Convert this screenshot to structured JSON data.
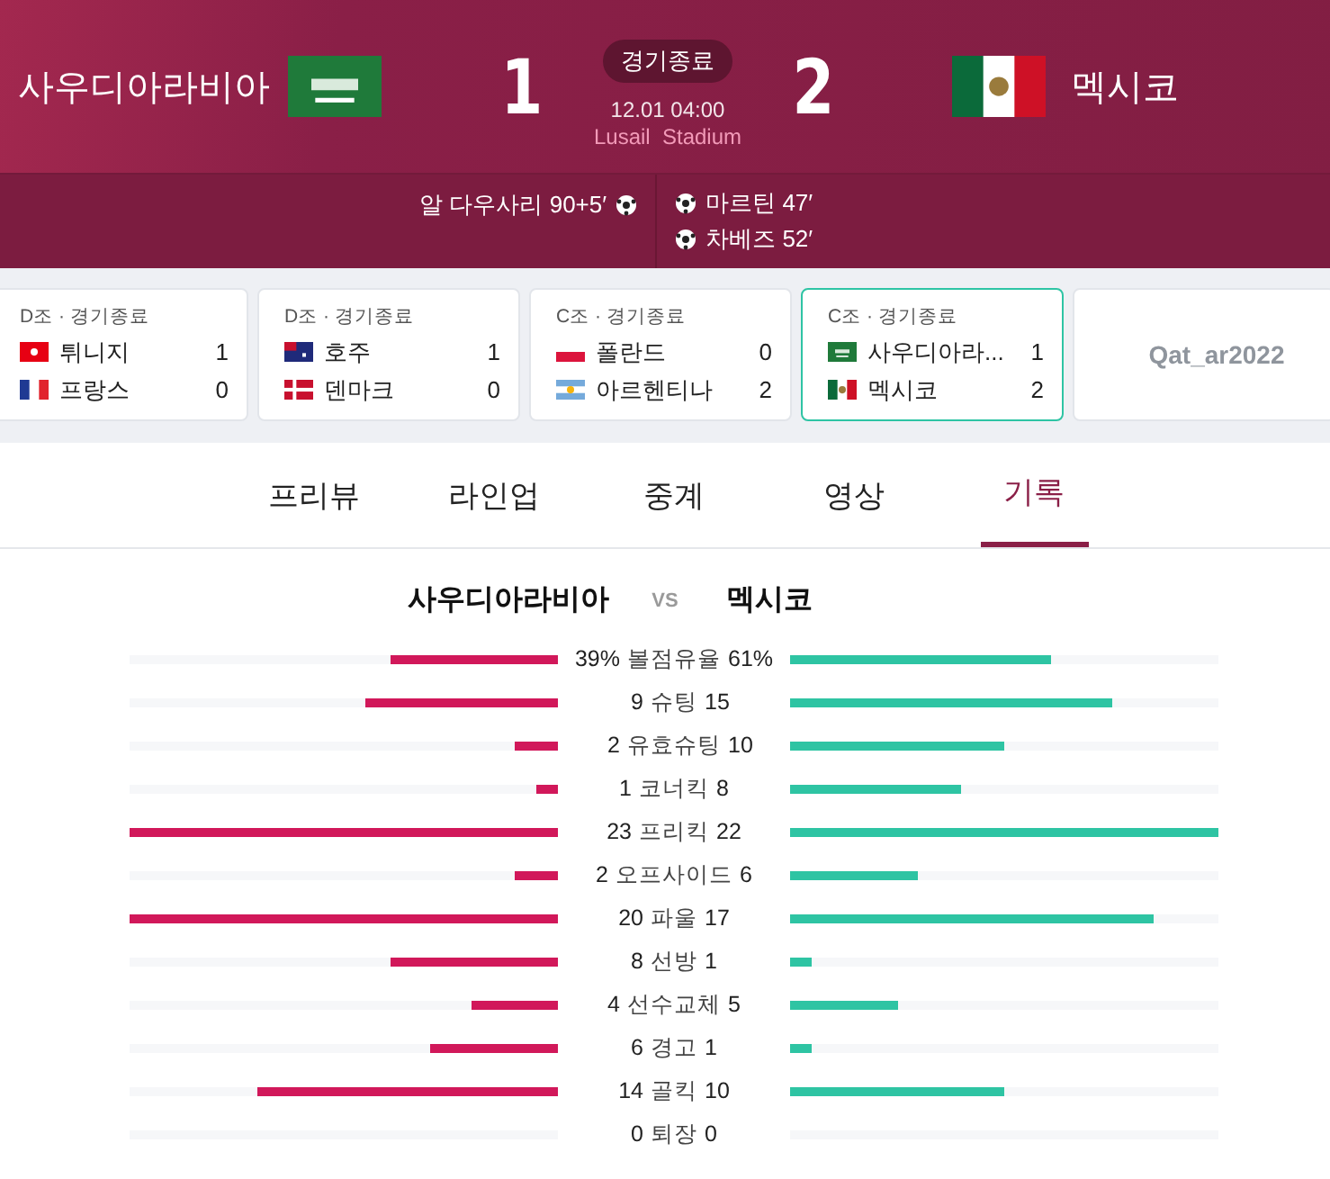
{
  "match": {
    "home": {
      "name": "사우디아라비아",
      "score": "1"
    },
    "away": {
      "name": "멕시코",
      "score": "2"
    },
    "status": "경기종료",
    "datetime": "12.01 04:00",
    "venue": "Lusail  Stadium",
    "goals": {
      "home": [
        {
          "text": "알 다우사리 90+5′"
        }
      ],
      "away": [
        {
          "text": "마르틴 47′"
        },
        {
          "text": "차베즈 52′"
        }
      ]
    }
  },
  "other_matches": [
    {
      "kind": "match",
      "header": "D조 · 경기종료",
      "selected": false,
      "teams": [
        {
          "name": "튀니지",
          "score": "1"
        },
        {
          "name": "프랑스",
          "score": "0"
        }
      ]
    },
    {
      "kind": "match",
      "header": "D조 · 경기종료",
      "selected": false,
      "teams": [
        {
          "name": "호주",
          "score": "1"
        },
        {
          "name": "덴마크",
          "score": "0"
        }
      ]
    },
    {
      "kind": "match",
      "header": "C조 · 경기종료",
      "selected": false,
      "teams": [
        {
          "name": "폴란드",
          "score": "0"
        },
        {
          "name": "아르헨티나",
          "score": "2"
        }
      ]
    },
    {
      "kind": "match",
      "header": "C조 · 경기종료",
      "selected": true,
      "teams": [
        {
          "name": "사우디아라...",
          "score": "1"
        },
        {
          "name": "멕시코",
          "score": "2"
        }
      ]
    },
    {
      "kind": "logo",
      "text": "Qat_ar2022"
    }
  ],
  "tabs": [
    {
      "label": "프리뷰",
      "selected": false
    },
    {
      "label": "라인업",
      "selected": false
    },
    {
      "label": "중계",
      "selected": false
    },
    {
      "label": "영상",
      "selected": false
    },
    {
      "label": "기록",
      "selected": true
    }
  ],
  "stats": {
    "home_name": "사우디아라비아",
    "vs": "VS",
    "away_name": "멕시코",
    "rows": [
      {
        "label": "볼점유율",
        "home": {
          "value": "39%",
          "level": 0.39
        },
        "away": {
          "value": "61%",
          "level": 0.61
        }
      },
      {
        "label": "슈팅",
        "home": {
          "value": "9",
          "level": 0.45
        },
        "away": {
          "value": "15",
          "level": 0.75
        }
      },
      {
        "label": "유효슈팅",
        "home": {
          "value": "2",
          "level": 0.1
        },
        "away": {
          "value": "10",
          "level": 0.5
        }
      },
      {
        "label": "코너킥",
        "home": {
          "value": "1",
          "level": 0.05
        },
        "away": {
          "value": "8",
          "level": 0.4
        }
      },
      {
        "label": "프리킥",
        "home": {
          "value": "23",
          "level": 1
        },
        "away": {
          "value": "22",
          "level": 1
        }
      },
      {
        "label": "오프사이드",
        "home": {
          "value": "2",
          "level": 0.1
        },
        "away": {
          "value": "6",
          "level": 0.3
        }
      },
      {
        "label": "파울",
        "home": {
          "value": "20",
          "level": 1
        },
        "away": {
          "value": "17",
          "level": 0.85
        }
      },
      {
        "label": "선방",
        "home": {
          "value": "8",
          "level": 0.39
        },
        "away": {
          "value": "1",
          "level": 0.05
        }
      },
      {
        "label": "선수교체",
        "home": {
          "value": "4",
          "level": 0.2
        },
        "away": {
          "value": "5",
          "level": 0.25
        }
      },
      {
        "label": "경고",
        "home": {
          "value": "6",
          "level": 0.3
        },
        "away": {
          "value": "1",
          "level": 0.05
        }
      },
      {
        "label": "골킥",
        "home": {
          "value": "14",
          "level": 0.7
        },
        "away": {
          "value": "10",
          "level": 0.5
        }
      },
      {
        "label": "퇴장",
        "home": {
          "value": "0",
          "level": 0
        },
        "away": {
          "value": "0",
          "level": 0
        }
      }
    ]
  }
}
